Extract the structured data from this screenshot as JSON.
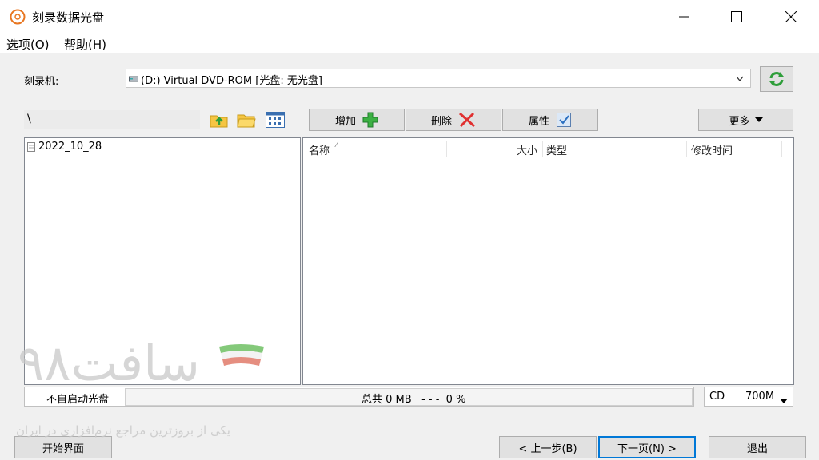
{
  "window": {
    "title": "刻录数据光盘",
    "icon": "disc-icon",
    "controls": [
      "minimize-icon",
      "maximize-icon",
      "close-icon"
    ]
  },
  "menu": {
    "items": [
      "选项(O)",
      "帮助(H)"
    ]
  },
  "burner": {
    "label": "刻录机:",
    "drive": "(D:) Virtual DVD-ROM [光盘:  无光盘]",
    "refresh_icon": "refresh-icon"
  },
  "path": {
    "value": "\\"
  },
  "toolbar": {
    "add": "增加",
    "delete": "删除",
    "properties": "属性",
    "more": "更多"
  },
  "tree": {
    "items": [
      "2022_10_28"
    ]
  },
  "file_list": {
    "columns": [
      "名称",
      "大小",
      "类型",
      "修改时间"
    ],
    "sort_indicator": "⁄"
  },
  "status": {
    "checkbox_label": "不自启动光盘",
    "total": "总共 0 MB   - - -  0 %",
    "disc_type": "CD",
    "disc_size": "700M"
  },
  "footer": {
    "start_screen": "开始界面",
    "back": "< 上一步(B)",
    "next": "下一页(N) >",
    "exit": "退出"
  },
  "watermark": {
    "brand": "سافت۹۸",
    "tagline": "یکی از بروزترین مراجع نرم‌افزاری در ایران"
  },
  "colors": {
    "background": "#f0f0f0",
    "accent_focus": "#0078d7",
    "add_icon": "#3cb043",
    "delete_icon": "#e03030"
  }
}
